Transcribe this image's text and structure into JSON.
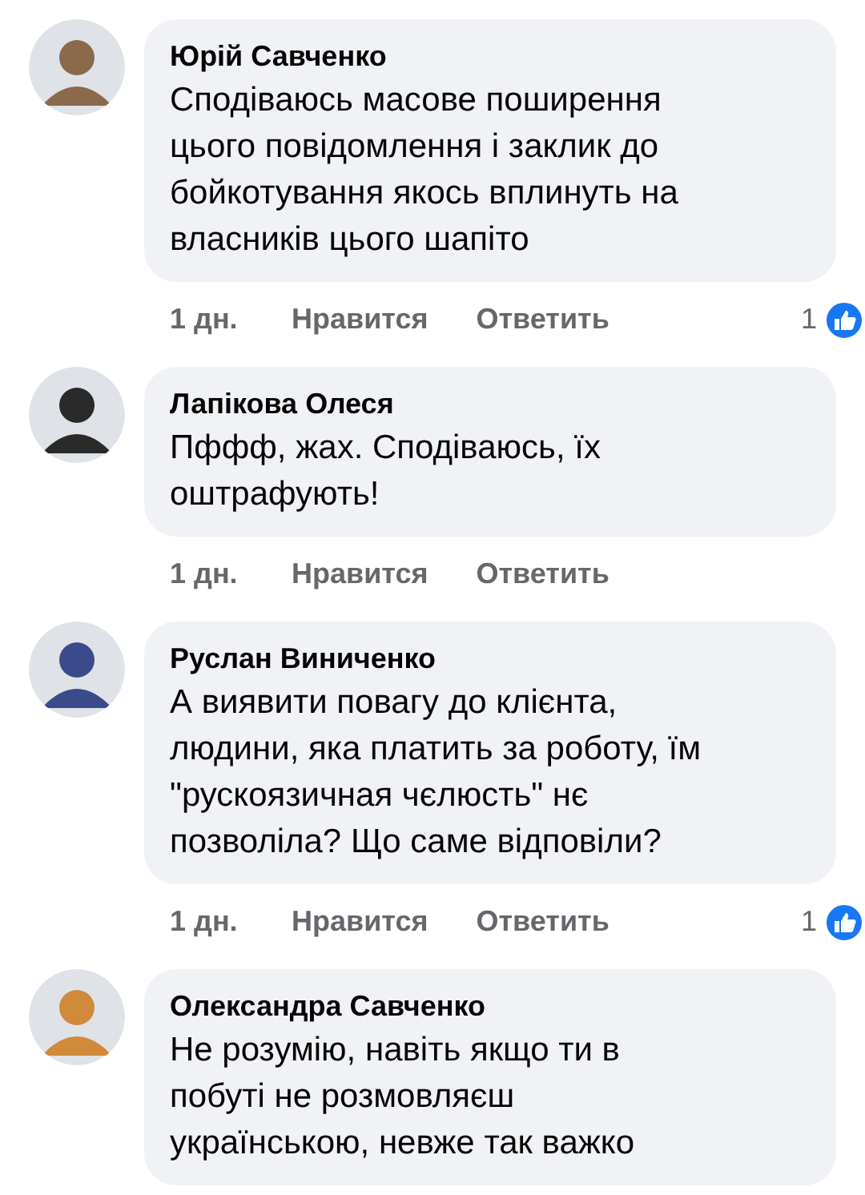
{
  "comments": [
    {
      "author": "Юрій Савченко",
      "text": "Сподіваюсь масове поширення цього повідомлення і заклик до бойкотування якось вплинуть на власників цього шапіто",
      "time": "1 дн.",
      "like": "Нравится",
      "reply": "Ответить",
      "reactions": "1"
    },
    {
      "author": "Лапікова Олеся",
      "text": "Пффф, жах. Сподіваюсь, їх оштрафують!",
      "time": "1 дн.",
      "like": "Нравится",
      "reply": "Ответить"
    },
    {
      "author": "Руслан Виниченко",
      "text": "А виявити повагу до клієнта, людини, яка платить за роботу, їм \"рускоязичная чєлюсть\" нє позволіла? Що саме відповіли?",
      "time": "1 дн.",
      "like": "Нравится",
      "reply": "Ответить",
      "reactions": "1"
    },
    {
      "author": "Олександра Савченко",
      "text": "Не розумію, навіть якщо ти в побуті не розмовляєш українською, невже так важко"
    }
  ]
}
